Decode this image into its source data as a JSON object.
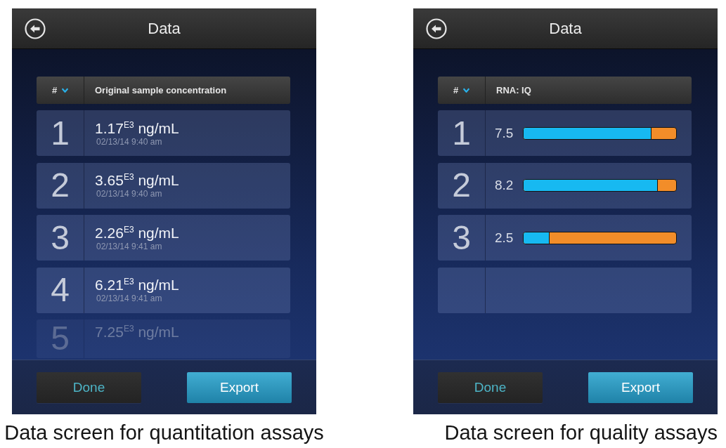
{
  "figures": [
    {
      "screen": {
        "title": "Data",
        "table": {
          "columns": [
            "#",
            "Original sample concentration"
          ],
          "rows": [
            {
              "kind": "concentration",
              "number": "1",
              "value": "1.17$^{E3}$ ng/mL",
              "timestamp": "02/13/14 9:40 am",
              "faded": false
            },
            {
              "kind": "concentration",
              "number": "2",
              "value": "3.65$^{E3}$ ng/mL",
              "timestamp": "02/13/14 9:40 am",
              "faded": false
            },
            {
              "kind": "concentration",
              "number": "3",
              "value": "2.26$^{E3}$ ng/mL",
              "timestamp": "02/13/14 9:41 am",
              "faded": false
            },
            {
              "kind": "concentration",
              "number": "4",
              "value": "6.21$^{E3}$ ng/mL",
              "timestamp": "02/13/14 9:41 am",
              "faded": false
            },
            {
              "kind": "concentration",
              "number": "5",
              "value": "7.25$^{E3}$ ng/mL",
              "faded": true
            }
          ]
        },
        "buttons": [
          {
            "label": "Done",
            "kind": "secondary"
          },
          {
            "label": "Export",
            "kind": "primary"
          }
        ]
      },
      "caption": "Data screen for quantitation assays"
    },
    {
      "screen": {
        "title": "Data",
        "table": {
          "columns": [
            "#",
            "RNA: IQ"
          ],
          "rows": [
            {
              "kind": "score",
              "number": "1",
              "reading": "7.5",
              "level": 0.84
            },
            {
              "kind": "score",
              "number": "2",
              "reading": "8.2",
              "level": 0.88
            },
            {
              "kind": "score",
              "number": "3",
              "reading": "2.5",
              "level": 0.17
            },
            {
              "kind": "empty"
            }
          ]
        },
        "buttons": [
          {
            "label": "Done",
            "kind": "secondary"
          },
          {
            "label": "Export",
            "kind": "primary"
          }
        ]
      },
      "caption": "Data screen for quality assays"
    }
  ]
}
